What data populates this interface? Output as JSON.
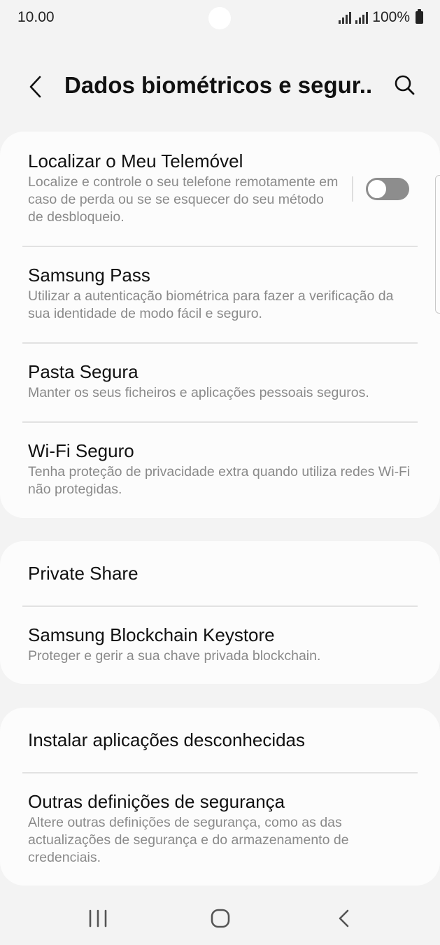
{
  "status_bar": {
    "time": "10.00",
    "battery": "100%"
  },
  "header": {
    "title": "Dados biométricos e segur..."
  },
  "card1": [
    {
      "title": "Localizar o Meu Telemóvel",
      "description": "Localize e controle o seu telefone remotamente em caso de perda ou se se esquecer do seu método de desbloqueio.",
      "toggle": "off"
    },
    {
      "title": "Samsung Pass",
      "description": "Utilizar a autenticação biométrica para fazer a verificação da sua identidade de modo fácil e seguro."
    },
    {
      "title": "Pasta Segura",
      "description": "Manter os seus ficheiros e aplicações pessoais seguros."
    },
    {
      "title": "Wi-Fi Seguro",
      "description": "Tenha proteção de privacidade extra quando utiliza redes Wi-Fi não protegidas."
    }
  ],
  "card2": [
    {
      "title": "Private Share"
    },
    {
      "title": "Samsung Blockchain Keystore",
      "description": "Proteger e gerir a sua chave privada blockchain."
    }
  ],
  "card3": [
    {
      "title": "Instalar aplicações desconhecidas"
    },
    {
      "title": "Outras definições de segurança",
      "description": "Altere outras definições de segurança, como as das actualizações de segurança e do armazenamento de credenciais."
    }
  ],
  "icons": {
    "back": "chevron-left-icon",
    "search": "search-icon",
    "nav_recents": "recents-icon",
    "nav_home": "home-icon",
    "nav_back": "back-icon"
  },
  "colors": {
    "background": "#f3f3f3",
    "card": "#fcfcfc",
    "secondary_text": "#8a8a8a",
    "toggle_off": "#8d8d8d"
  }
}
